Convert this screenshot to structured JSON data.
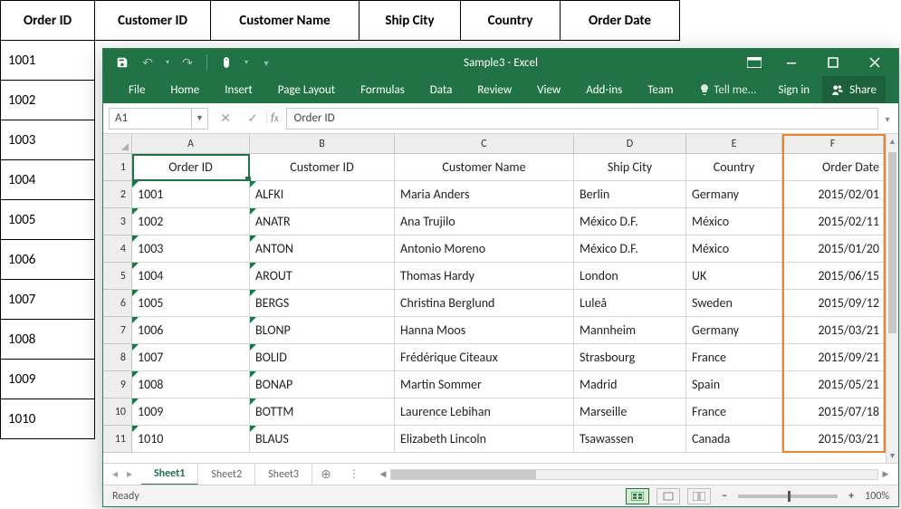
{
  "bg_table": {
    "headers": [
      "Order ID",
      "Customer ID",
      "Customer Name",
      "Ship City",
      "Country",
      "Order Date"
    ],
    "rows": [
      "1001",
      "1002",
      "1003",
      "1004",
      "1005",
      "1006",
      "1007",
      "1008",
      "1009",
      "1010"
    ]
  },
  "title": "Sample3 - Excel",
  "ribbon_tabs": [
    "File",
    "Home",
    "Insert",
    "Page Layout",
    "Formulas",
    "Data",
    "Review",
    "View",
    "Add-ins",
    "Team"
  ],
  "tell_me": "Tell me...",
  "signin": "Sign in",
  "share": "Share",
  "namebox": "A1",
  "formula": "Order ID",
  "columns": [
    "A",
    "B",
    "C",
    "D",
    "E",
    "F"
  ],
  "col_widths": [
    "cw-A",
    "cw-B",
    "cw-C",
    "cw-D",
    "cw-E",
    "cw-F"
  ],
  "chart_data": {
    "type": "table",
    "title": "",
    "headers": [
      "Order ID",
      "Customer ID",
      "Customer Name",
      "Ship City",
      "Country",
      "Order Date"
    ],
    "rows": [
      [
        "1001",
        "ALFKI",
        "Maria Anders",
        "Berlin",
        "Germany",
        "2015/02/01"
      ],
      [
        "1002",
        "ANATR",
        "Ana Trujilo",
        "México D.F.",
        "México",
        "2015/02/11"
      ],
      [
        "1003",
        "ANTON",
        "Antonio Moreno",
        "México D.F.",
        "México",
        "2015/01/20"
      ],
      [
        "1004",
        "AROUT",
        "Thomas Hardy",
        "London",
        "UK",
        "2015/06/15"
      ],
      [
        "1005",
        "BERGS",
        "Christina Berglund",
        "Luleå",
        "Sweden",
        "2015/09/12"
      ],
      [
        "1006",
        "BLONP",
        "Hanna Moos",
        "Mannheim",
        "Germany",
        "2015/03/21"
      ],
      [
        "1007",
        "BOLID",
        "Frédérique Citeaux",
        "Strasbourg",
        "France",
        "2015/09/21"
      ],
      [
        "1008",
        "BONAP",
        "Martin Sommer",
        "Madrid",
        "Spain",
        "2015/05/21"
      ],
      [
        "1009",
        "BOTTM",
        "Laurence Lebihan",
        "Marseille",
        "France",
        "2015/07/18"
      ],
      [
        "1010",
        "BLAUS",
        "Elizabeth Lincoln",
        "Tsawassen",
        "Canada",
        "2015/03/21"
      ]
    ],
    "highlighted_column_index": 5
  },
  "sheets": [
    "Sheet1",
    "Sheet2",
    "Sheet3"
  ],
  "active_sheet": 0,
  "status": "Ready",
  "zoom": "100%"
}
